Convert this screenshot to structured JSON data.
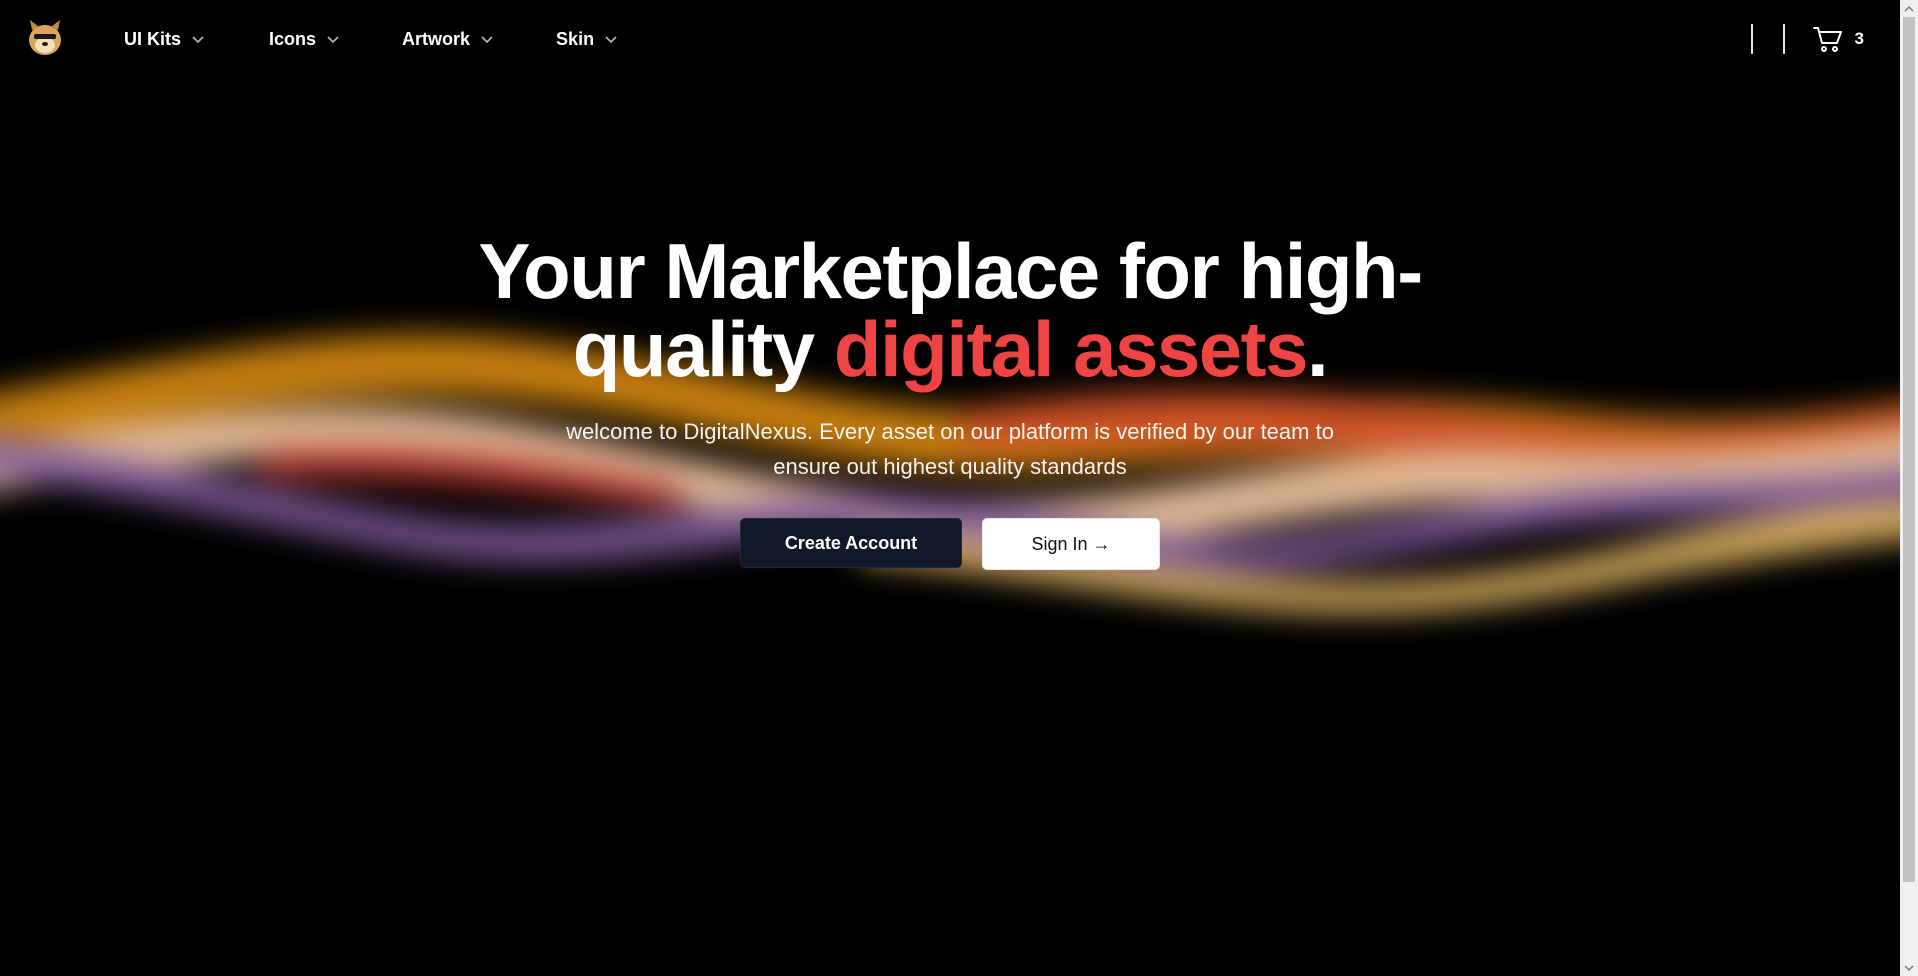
{
  "nav": {
    "logo_icon": "doge-logo-icon",
    "items": [
      {
        "label": "UI Kits"
      },
      {
        "label": "Icons"
      },
      {
        "label": "Artwork"
      },
      {
        "label": "Skin"
      }
    ],
    "cart_count": "3"
  },
  "hero": {
    "title_part1": "Your Marketplace for high-quality ",
    "title_accent": "digital assets",
    "title_end": ".",
    "subtitle": "welcome to DigitalNexus. Every asset on our platform is verified by our team to ensure out highest quality standards",
    "primary_button": "Create Account",
    "secondary_button": "Sign In →"
  },
  "colors": {
    "background": "#000000",
    "accent": "#ef4444",
    "primary_button_bg": "#111827",
    "wave_orange": "#d98a12",
    "wave_peach": "#f2c8a8",
    "wave_purple": "#8a63a8",
    "wave_red": "#d9532a"
  }
}
